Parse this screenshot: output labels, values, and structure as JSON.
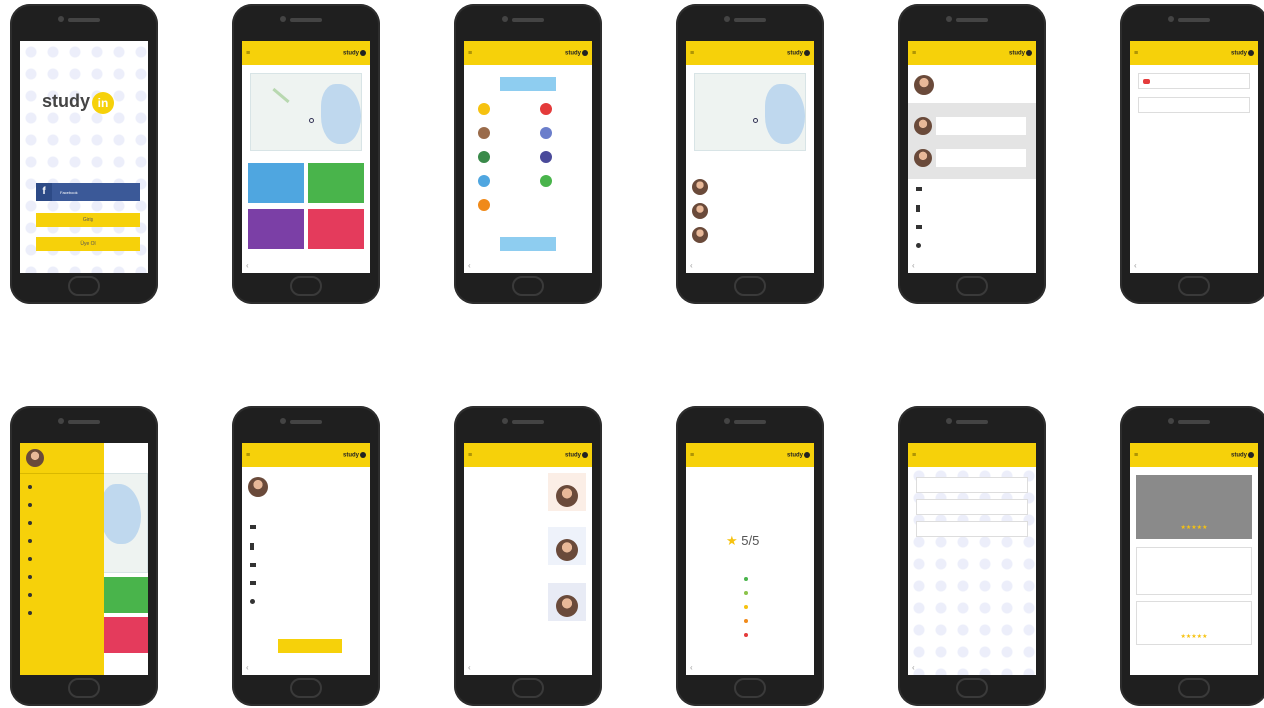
{
  "brand": {
    "name_left": "study",
    "name_right": "in",
    "accent": "#f6d10a"
  },
  "screens": {
    "splash": {
      "facebook_label": "Facebook",
      "btn1": "Giriş",
      "btn2": "Üye Ol"
    },
    "home": {
      "title": "",
      "caption": "",
      "tiles": [
        {
          "label": "",
          "color": "#4fa6e0"
        },
        {
          "label": "",
          "color": "#49b44b"
        },
        {
          "label": "",
          "color": "#7b3fa6"
        },
        {
          "label": "",
          "color": "#e43b5c"
        }
      ]
    },
    "subjects": {
      "items": [
        {
          "color": "#f6c210"
        },
        {
          "color": "#e43b3b"
        },
        {
          "color": "#9a6b4a"
        },
        {
          "color": "#6b7ecb"
        },
        {
          "color": "#3a8a4a"
        },
        {
          "color": "#4a4a9a"
        },
        {
          "color": "#4fa6e0"
        },
        {
          "color": "#49b44b"
        },
        {
          "color": "#f08a1a"
        }
      ]
    },
    "rating": {
      "score": "5/5",
      "bars": [
        {
          "color": "#49b44b"
        },
        {
          "color": "#8bc34a"
        },
        {
          "color": "#f6c210"
        },
        {
          "color": "#f08a1a"
        },
        {
          "color": "#e43b3b"
        }
      ]
    }
  }
}
